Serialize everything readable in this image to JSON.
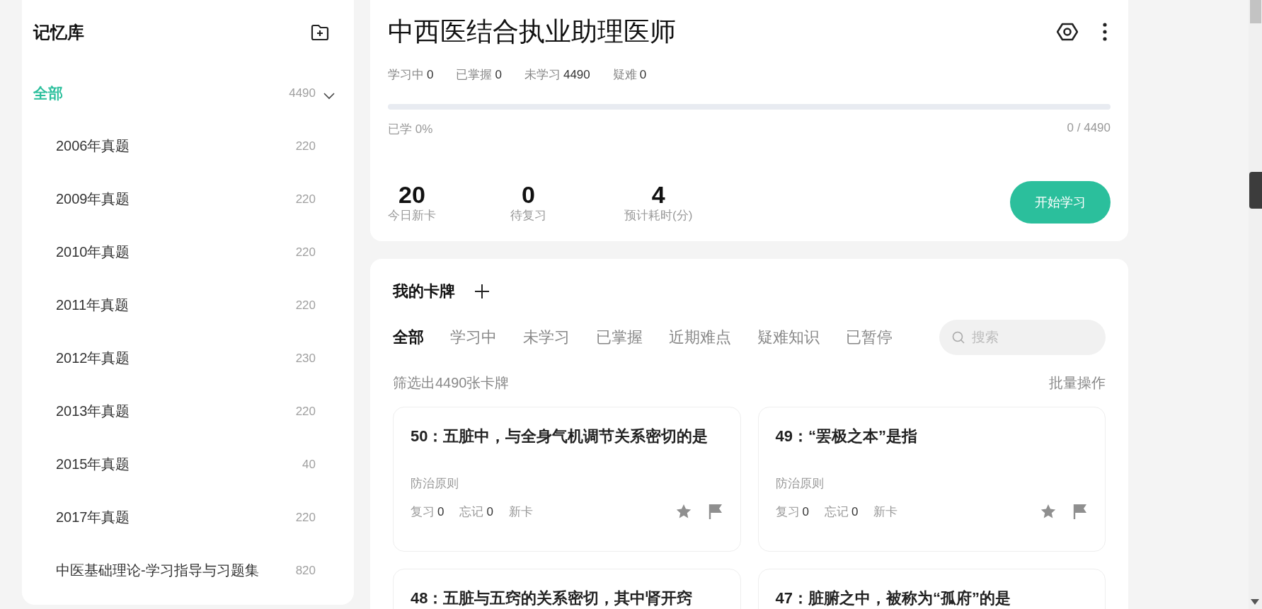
{
  "sidebar": {
    "title": "记忆库",
    "items": [
      {
        "label": "全部",
        "count": "4490",
        "selected": true,
        "expanded": true,
        "children": [
          {
            "label": "2006年真题",
            "count": "220",
            "selected": false
          },
          {
            "label": "2009年真题",
            "count": "220",
            "selected": false
          },
          {
            "label": "2010年真题",
            "count": "220",
            "selected": false
          },
          {
            "label": "2011年真题",
            "count": "220",
            "selected": false
          },
          {
            "label": "2012年真题",
            "count": "230",
            "selected": false
          },
          {
            "label": "2013年真题",
            "count": "220",
            "selected": false
          },
          {
            "label": "2015年真题",
            "count": "40",
            "selected": false
          },
          {
            "label": "2017年真题",
            "count": "220",
            "selected": false
          },
          {
            "label": "中医基础理论-学习指导与习题集",
            "count": "820",
            "selected": false
          }
        ]
      }
    ]
  },
  "deck": {
    "title": "中西医结合执业助理医师",
    "stats": [
      {
        "label": "学习中",
        "value": "0"
      },
      {
        "label": "已掌握",
        "value": "0"
      },
      {
        "label": "未学习",
        "value": "4490"
      },
      {
        "label": "疑难",
        "value": "0"
      }
    ],
    "progress": {
      "label": "已学 0%",
      "count": "0 / 4490",
      "level": 0
    },
    "summary": [
      {
        "value": "20",
        "label": "今日新卡"
      },
      {
        "value": "0",
        "label": "待复习"
      },
      {
        "value": "4",
        "label": "预计耗时(分)"
      }
    ],
    "start_button": "开始学习"
  },
  "cards_panel": {
    "title": "我的卡牌",
    "tabs": [
      {
        "label": "全部",
        "selected": true
      },
      {
        "label": "学习中",
        "selected": false
      },
      {
        "label": "未学习",
        "selected": false
      },
      {
        "label": "已掌握",
        "selected": false
      },
      {
        "label": "近期难点",
        "selected": false
      },
      {
        "label": "疑难知识",
        "selected": false
      },
      {
        "label": "已暂停",
        "selected": false
      }
    ],
    "search": {
      "placeholder": "搜索"
    },
    "filter_text": "筛选出4490张卡牌",
    "batch_action": "批量操作",
    "cards": [
      {
        "title": "50：五脏中，与全身气机调节关系密切的是",
        "tag": "防治原则",
        "stats": [
          {
            "label": "复习",
            "value": "0"
          },
          {
            "label": "忘记",
            "value": "0"
          }
        ],
        "status": "新卡"
      },
      {
        "title": "49：“罢极之本”是指",
        "tag": "防治原则",
        "stats": [
          {
            "label": "复习",
            "value": "0"
          },
          {
            "label": "忘记",
            "value": "0"
          }
        ],
        "status": "新卡"
      },
      {
        "title": "48：五脏与五窍的关系密切，其中肾开窍"
      },
      {
        "title": "47：脏腑之中，被称为“孤府”的是"
      }
    ]
  }
}
